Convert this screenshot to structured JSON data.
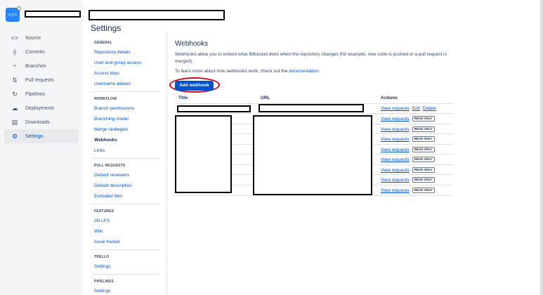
{
  "repo": {
    "avatar_glyph": "</>"
  },
  "nav": {
    "items": [
      {
        "label": "Source",
        "icon": "code-icon",
        "glyph": "<>"
      },
      {
        "label": "Commits",
        "icon": "commit-icon",
        "glyph": "⟠"
      },
      {
        "label": "Branches",
        "icon": "branch-icon",
        "glyph": "⑂"
      },
      {
        "label": "Pull requests",
        "icon": "pull-request-icon",
        "glyph": "⇅"
      },
      {
        "label": "Pipelines",
        "icon": "pipelines-icon",
        "glyph": "↻"
      },
      {
        "label": "Deployments",
        "icon": "cloud-icon",
        "glyph": "☁"
      },
      {
        "label": "Downloads",
        "icon": "file-icon",
        "glyph": "▤"
      },
      {
        "label": "Settings",
        "icon": "gear-icon",
        "glyph": "⚙"
      }
    ]
  },
  "page": {
    "title": "Settings"
  },
  "settings_nav": {
    "sections": [
      {
        "heading": "GENERAL",
        "links": [
          "Repository details",
          "User and group access",
          "Access keys",
          "Username aliases"
        ]
      },
      {
        "heading": "WORKFLOW",
        "links": [
          "Branch permissions",
          "Branching model",
          "Merge strategies",
          "Webhooks",
          "Links"
        ]
      },
      {
        "heading": "PULL REQUESTS",
        "links": [
          "Default reviewers",
          "Default description",
          "Excluded files"
        ]
      },
      {
        "heading": "FEATURES",
        "links": [
          "Git LFS",
          "Wiki",
          "Issue tracker"
        ]
      },
      {
        "heading": "TRELLO",
        "links": [
          "Settings"
        ]
      },
      {
        "heading": "PIPELINES",
        "links": [
          "Settings"
        ]
      }
    ]
  },
  "webhooks": {
    "title": "Webhooks",
    "description": "Webhooks allow you to extend what Bitbucket does when the repository changes (for example, new code is pushed or a pull request is merged).",
    "learn_more_prefix": "To learn more about how webhooks work, check out the",
    "learn_more_link": "documentation",
    "learn_more_suffix": ".",
    "add_button": "Add webhook",
    "columns": {
      "title": "Title",
      "url": "URL",
      "actions": "Actions"
    },
    "view_requests": "View requests",
    "edit": "Edit",
    "delete": "Delete",
    "read_only": "READ ONLY"
  }
}
